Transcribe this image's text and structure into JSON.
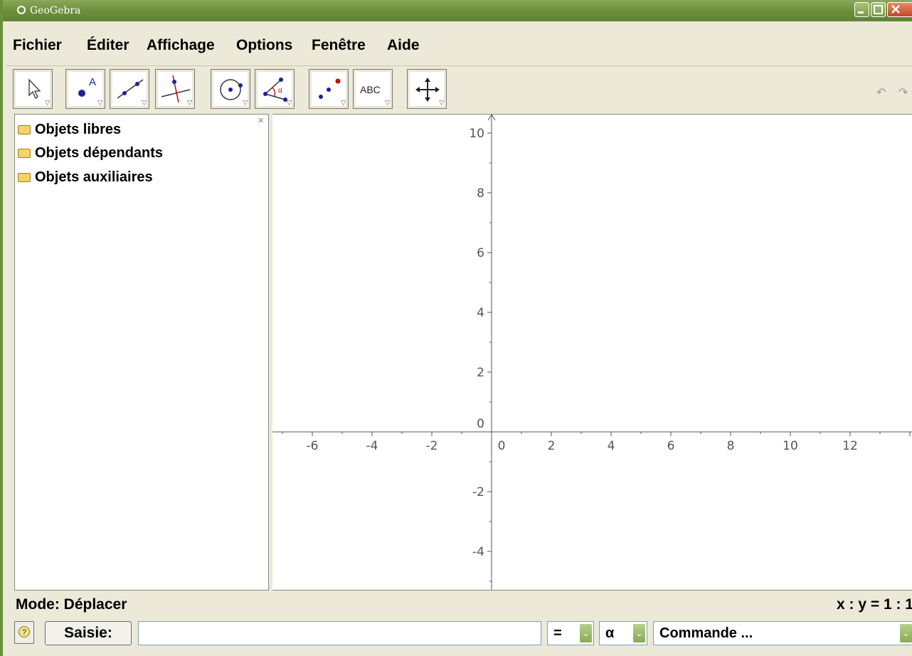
{
  "window": {
    "title": "GeoGebra"
  },
  "menu": [
    "Fichier",
    "Éditer",
    "Affichage",
    "Options",
    "Fenêtre",
    "Aide"
  ],
  "toolbar": {
    "tools": [
      {
        "name": "move-tool",
        "icon": "arrow-cursor-icon",
        "label": ""
      },
      {
        "name": "point-tool",
        "icon": "point-A-icon",
        "label": ""
      },
      {
        "name": "line-tool",
        "icon": "line-through-points-icon",
        "label": ""
      },
      {
        "name": "perpendicular-tool",
        "icon": "perpendicular-line-icon",
        "label": ""
      },
      {
        "name": "circle-tool",
        "icon": "circle-center-point-icon",
        "label": ""
      },
      {
        "name": "angle-tool",
        "icon": "angle-icon",
        "label": ""
      },
      {
        "name": "reflect-tool",
        "icon": "reflect-points-icon",
        "label": ""
      },
      {
        "name": "text-tool",
        "icon": "text-abc-icon",
        "label": "ABC"
      },
      {
        "name": "move-view-tool",
        "icon": "move-graphics-view-icon",
        "label": ""
      }
    ]
  },
  "algebra": {
    "folders": [
      "Objets libres",
      "Objets dépendants",
      "Objets auxiliaires"
    ]
  },
  "graphics": {
    "x_ticks": [
      "-6",
      "-4",
      "-2",
      "0",
      "2",
      "4",
      "6",
      "8",
      "10",
      "12"
    ],
    "y_ticks": [
      "10",
      "8",
      "6",
      "4",
      "2",
      "0",
      "-2",
      "-4"
    ]
  },
  "status": {
    "mode": "Mode: Déplacer",
    "ratio": "x : y = 1 : 1"
  },
  "input_bar": {
    "saisie_label": "Saisie:",
    "input_value": "",
    "equals_combo": "=",
    "alpha_combo": "α",
    "command_combo": "Commande ..."
  },
  "colors": {
    "title_bar": "#6d8f3c",
    "point_blue": "#1f1fa0",
    "accent_red": "#d00000"
  }
}
